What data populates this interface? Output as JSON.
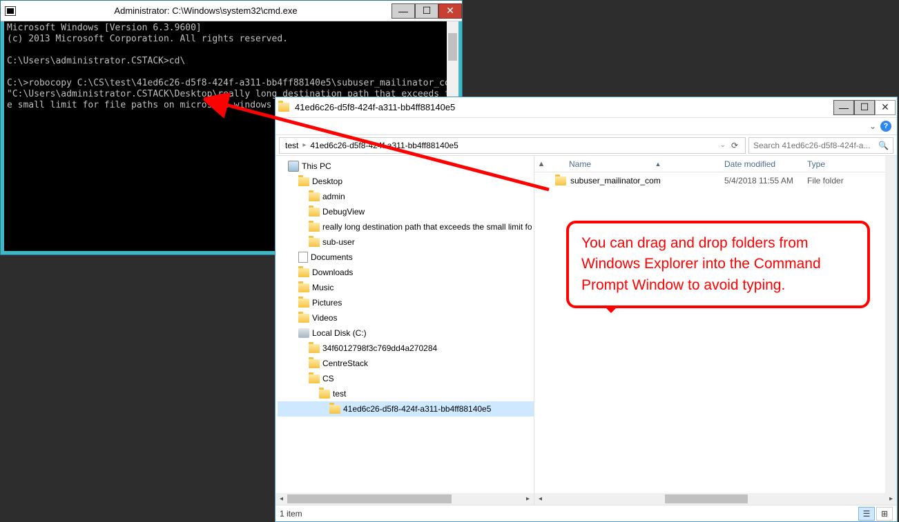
{
  "cmd": {
    "title": "Administrator: C:\\Windows\\system32\\cmd.exe",
    "line1": "Microsoft Windows [Version 6.3.9600]",
    "line2": "(c) 2013 Microsoft Corporation. All rights reserved.",
    "line3": "C:\\Users\\administrator.CSTACK>cd\\",
    "line4": "C:\\>robocopy C:\\CS\\test\\41ed6c26-d5f8-424f-a311-bb4ff88140e5\\subuser_mailinator_com \"C:\\Users\\administrator.CSTACK\\Desktop\\really long destination path that exceeds the small limit for file paths on microsoft windows systems\" /E_"
  },
  "explorer": {
    "title": "41ed6c26-d5f8-424f-a311-bb4ff88140e5",
    "breadcrumb1": "test",
    "breadcrumb2": "41ed6c26-d5f8-424f-a311-bb4ff88140e5",
    "searchPlaceholder": "Search 41ed6c26-d5f8-424f-a...",
    "cols": {
      "name": "Name",
      "date": "Date modified",
      "type": "Type"
    },
    "row": {
      "name": "subuser_mailinator_com",
      "date": "5/4/2018 11:55 AM",
      "type": "File folder"
    },
    "status": "1 item",
    "tree": {
      "thispc": "This PC",
      "desktop": "Desktop",
      "admin": "admin",
      "debugview": "DebugView",
      "longpath": "really long destination path that exceeds the small limit fo",
      "subuser": "sub-user",
      "documents": "Documents",
      "downloads": "Downloads",
      "music": "Music",
      "pictures": "Pictures",
      "videos": "Videos",
      "localdisk": "Local Disk (C:)",
      "guid1": "34f6012798f3c769dd4a270284",
      "centrestack": "CentreStack",
      "cs": "CS",
      "test": "test",
      "guid2": "41ed6c26-d5f8-424f-a311-bb4ff88140e5"
    }
  },
  "callout": "You can drag and drop folders from Windows Explorer into the Command Prompt Window to avoid typing."
}
